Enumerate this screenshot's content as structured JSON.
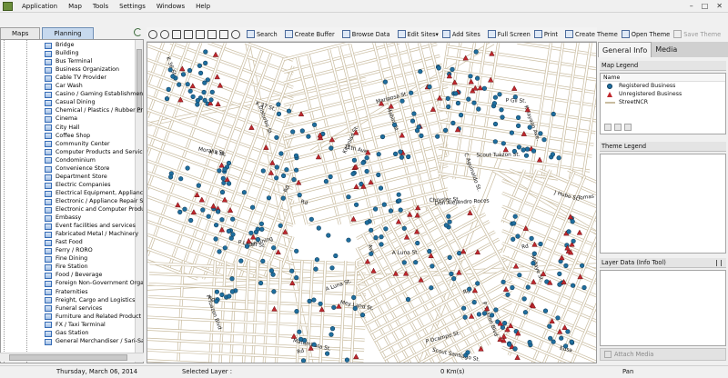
{
  "menu": {
    "items": [
      "Application",
      "Map",
      "Tools",
      "Settings",
      "Windows",
      "Help"
    ]
  },
  "left_panel": {
    "tabs": [
      "Maps",
      "Planning"
    ],
    "active_tab": "Planning",
    "layers": [
      "Bridge",
      "Building",
      "Bus Terminal",
      "Business Organization",
      "Cable TV Provider",
      "Car Wash",
      "Casino / Gaming Establishment",
      "Casual Dining",
      "Chemical / Plastics / Rubber Pr",
      "Cinema",
      "City Hall",
      "Coffee Shop",
      "Community Center",
      "Computer Products and Servic",
      "Condominium",
      "Convenience Store",
      "Department Store",
      "Electric Companies",
      "Electrical Equipment, Appliance",
      "Electronic / Appliance Repair S",
      "Electronic and Computer Produ",
      "Embassy",
      "Event facilities and services",
      "Fabricated Metal / Machinery",
      "Fast Food",
      "Ferry / RORO",
      "Fine Dining",
      "Fire Station",
      "Food / Beverage",
      "Foreign Non-Government Orga",
      "Fraternities",
      "Freight, Cargo and Logistics",
      "Funeral services",
      "Furniture and Related Product",
      "FX / Taxi Terminal",
      "Gas Station",
      "General Merchandiser / Sari-Sa"
    ]
  },
  "toolbar": {
    "search": "Search",
    "create_buffer": "Create Buffer",
    "browse_data": "Browse Data",
    "edit_sites": "Edit Sites",
    "add_sites": "Add Sites",
    "full_screen": "Full Screen",
    "print": "Print",
    "create_theme": "Create Theme",
    "open_theme": "Open Theme",
    "save_theme": "Save Theme"
  },
  "map": {
    "colors": {
      "registered": "#1f6f9f",
      "unregistered": "#c0272d",
      "street": "#c9bca0"
    },
    "street_labels": [
      "K 36 St.",
      "K 37 St.",
      "Kitanlad St.",
      "Don Alejandro Roces",
      "Midaye St.",
      "Rd",
      "Rd",
      "Mabini St.",
      "Scout Tuazon St.",
      "Tomas Morato Ave.",
      "Kamuning",
      "Mey Land St.",
      "Scout Santiago St.",
      "Kalayaan Ave.",
      "K 4 St.",
      "Rd",
      "A Luna St.",
      "P Tuazon Blvd",
      "Edsa",
      "Disturbo St.",
      "11th Ave.",
      "Chrysler St.",
      "Rd",
      "P Tuazon Blvd",
      "Matambata St.",
      "Mariposa St.",
      "C Aguinaldo St.",
      "J Hubo St.",
      "P Lanzt St.",
      "A Luna St.",
      "P Ocampo St.",
      "P Gil St.",
      "Moralis St.",
      "Rd",
      "Ave.",
      "Rd"
    ]
  },
  "right_panel": {
    "tabs": [
      "General Info",
      "Media"
    ],
    "active_tab": "General Info",
    "map_legend_title": "Map Legend",
    "legend_header": "Name",
    "legend_items": [
      {
        "label": "Registered Business",
        "symbol": "circle-icon"
      },
      {
        "label": "Unregistered Business",
        "symbol": "triangle-icon"
      },
      {
        "label": "StreetNCR",
        "symbol": "line-icon"
      }
    ],
    "theme_legend_title": "Theme Legend",
    "layer_data_title": "Layer Data (Info Tool)",
    "attach_media": "Attach Media"
  },
  "status": {
    "date": "Thursday, March 06, 2014",
    "selected_layer": "Selected Layer :",
    "distance": "0 Km(s)",
    "mode": "Pan"
  }
}
